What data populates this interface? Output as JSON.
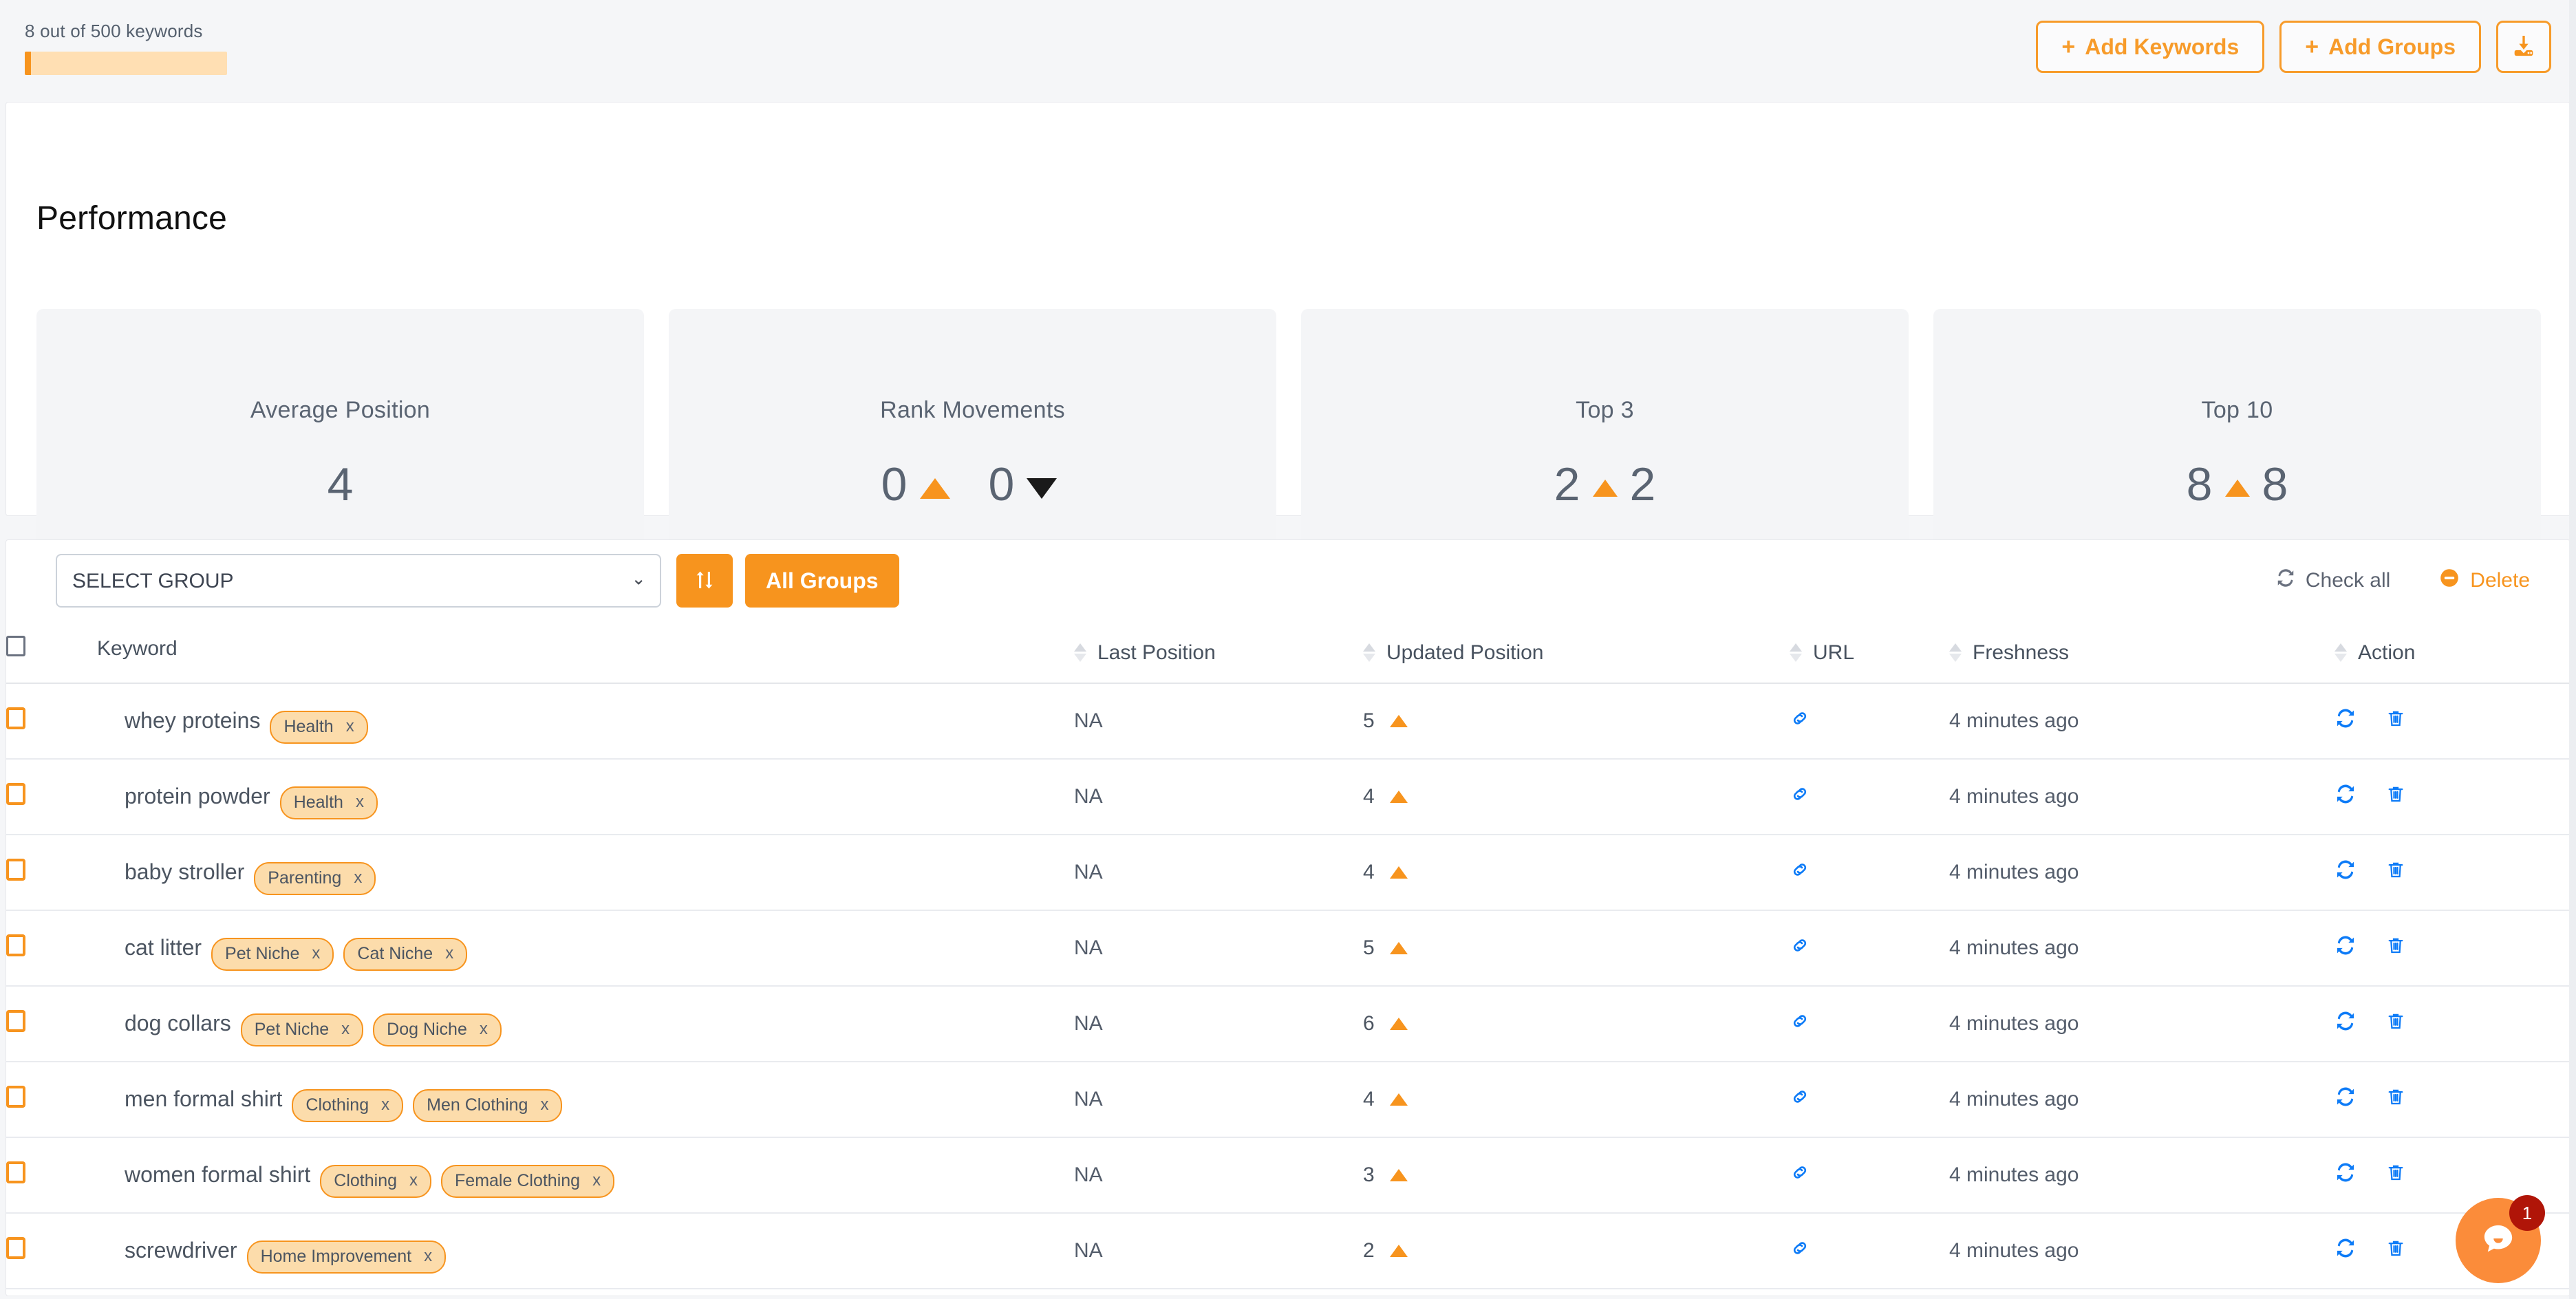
{
  "colors": {
    "accent_orange": "#f7941e",
    "tag_bg": "#fcdcab",
    "link_blue": "#0d7bf7",
    "text_slate": "#4c5561",
    "panel_bg": "#f4f5f7",
    "page_bg": "#f5f6f8",
    "badge_red": "#b01508"
  },
  "topbar": {
    "quota_label": "8 out of 500 keywords",
    "quota_used": 8,
    "quota_total": 500,
    "quota_percent": 1.6,
    "add_keywords_label": "Add Keywords",
    "add_groups_label": "Add Groups",
    "plus_glyph": "+",
    "download_icon": "download-icon"
  },
  "performance": {
    "title": "Performance",
    "cards": [
      {
        "label": "Average Position",
        "value": "4",
        "arrows": []
      },
      {
        "label": "Rank Movements",
        "value": "0",
        "value2": "0",
        "arrows": [
          "up",
          "down"
        ]
      },
      {
        "label": "Top 3",
        "value": "2",
        "value2": "2",
        "arrows": [
          "up"
        ]
      },
      {
        "label": "Top 10",
        "value": "8",
        "value2": "8",
        "arrows": [
          "up"
        ]
      }
    ]
  },
  "toolbar": {
    "select_value": "SELECT GROUP",
    "select_options": [
      "SELECT GROUP"
    ],
    "refresh_icon": "exchange-icon",
    "all_groups_label": "All Groups",
    "check_all_label": "Check all",
    "check_all_icon": "refresh-icon",
    "delete_label": "Delete",
    "delete_icon": "minus-circle-icon"
  },
  "table": {
    "columns": [
      {
        "key": "checkbox",
        "label": ""
      },
      {
        "key": "keyword",
        "label": "Keyword",
        "sortable": true
      },
      {
        "key": "last_position",
        "label": "Last Position",
        "sortable": true
      },
      {
        "key": "updated_position",
        "label": "Updated Position",
        "sortable": true
      },
      {
        "key": "url",
        "label": "URL",
        "sortable": true
      },
      {
        "key": "freshness",
        "label": "Freshness",
        "sortable": true
      },
      {
        "key": "action",
        "label": "Action",
        "sortable": true
      }
    ],
    "rows": [
      {
        "keyword": "whey proteins",
        "tags": [
          "Health"
        ],
        "last_position": "NA",
        "updated_position": "5",
        "trend": "up",
        "url_icon": "link-icon",
        "freshness": "4 minutes ago",
        "actions": [
          "refresh-icon",
          "trash-icon"
        ]
      },
      {
        "keyword": "protein powder",
        "tags": [
          "Health"
        ],
        "last_position": "NA",
        "updated_position": "4",
        "trend": "up",
        "url_icon": "link-icon",
        "freshness": "4 minutes ago",
        "actions": [
          "refresh-icon",
          "trash-icon"
        ]
      },
      {
        "keyword": "baby stroller",
        "tags": [
          "Parenting"
        ],
        "last_position": "NA",
        "updated_position": "4",
        "trend": "up",
        "url_icon": "link-icon",
        "freshness": "4 minutes ago",
        "actions": [
          "refresh-icon",
          "trash-icon"
        ]
      },
      {
        "keyword": "cat litter",
        "tags": [
          "Pet Niche",
          "Cat Niche"
        ],
        "last_position": "NA",
        "updated_position": "5",
        "trend": "up",
        "url_icon": "link-icon",
        "freshness": "4 minutes ago",
        "actions": [
          "refresh-icon",
          "trash-icon"
        ]
      },
      {
        "keyword": "dog collars",
        "tags": [
          "Pet Niche",
          "Dog Niche"
        ],
        "last_position": "NA",
        "updated_position": "6",
        "trend": "up",
        "url_icon": "link-icon",
        "freshness": "4 minutes ago",
        "actions": [
          "refresh-icon",
          "trash-icon"
        ]
      },
      {
        "keyword": "men formal shirt",
        "tags": [
          "Clothing",
          "Men Clothing"
        ],
        "last_position": "NA",
        "updated_position": "4",
        "trend": "up",
        "url_icon": "link-icon",
        "freshness": "4 minutes ago",
        "actions": [
          "refresh-icon",
          "trash-icon"
        ]
      },
      {
        "keyword": "women formal shirt",
        "tags": [
          "Clothing",
          "Female Clothing"
        ],
        "last_position": "NA",
        "updated_position": "3",
        "trend": "up",
        "url_icon": "link-icon",
        "freshness": "4 minutes ago",
        "actions": [
          "refresh-icon",
          "trash-icon"
        ]
      },
      {
        "keyword": "screwdriver",
        "tags": [
          "Home Improvement"
        ],
        "last_position": "NA",
        "updated_position": "2",
        "trend": "up",
        "url_icon": "link-icon",
        "freshness": "4 minutes ago",
        "actions": [
          "refresh-icon",
          "trash-icon"
        ]
      }
    ],
    "tag_remove_glyph": "x"
  },
  "chat": {
    "icon": "chat-bubble-icon",
    "badge_count": "1"
  }
}
